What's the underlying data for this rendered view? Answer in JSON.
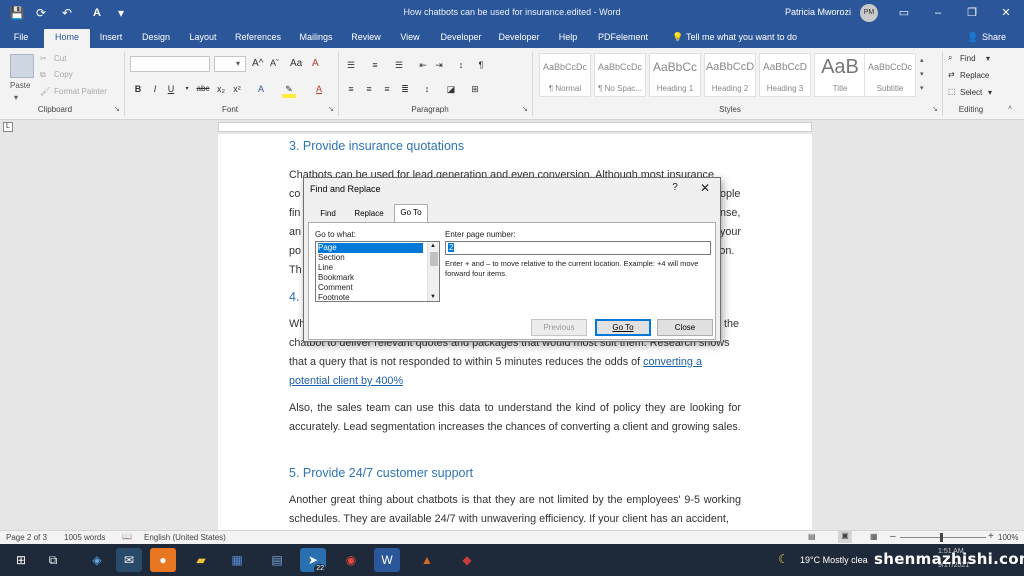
{
  "window": {
    "title": "How chatbots can be used for insurance.edited  -  Word",
    "user_name": "Patricia Mworozi",
    "user_initials": "PM",
    "autosave_icon": "save-icon",
    "minimize": "–",
    "restore": "❐",
    "close": "✕",
    "ribbon_display": "▭"
  },
  "tabs": [
    "File",
    "Home",
    "Insert",
    "Design",
    "Layout",
    "References",
    "Mailings",
    "Review",
    "View",
    "Developer",
    "Developer",
    "Help",
    "PDFelement"
  ],
  "active_tab": "Home",
  "tell_me": "Tell me what you want to do",
  "share": "Share",
  "clipboard": {
    "paste": "Paste",
    "cut": "Cut",
    "copy": "Copy",
    "format_painter": "Format Painter",
    "label": "Clipboard"
  },
  "font": {
    "label": "Font",
    "bold": "B",
    "italic": "I",
    "underline": "U",
    "strike": "abc",
    "sub": "x₂",
    "sup": "x²"
  },
  "paragraph": {
    "label": "Paragraph"
  },
  "styles": {
    "label": "Styles",
    "items": [
      {
        "preview": "AaBbCcDc",
        "name": "¶ Normal"
      },
      {
        "preview": "AaBbCcDc",
        "name": "¶ No Spac..."
      },
      {
        "preview": "AaBbCc",
        "name": "Heading 1"
      },
      {
        "preview": "AaBbCcD",
        "name": "Heading 2"
      },
      {
        "preview": "AaBbCcD",
        "name": "Heading 3"
      },
      {
        "preview": "AaB",
        "name": "Title"
      },
      {
        "preview": "AaBbCcDc",
        "name": "Subtitle"
      }
    ]
  },
  "editing": {
    "label": "Editing",
    "find": "Find",
    "replace": "Replace",
    "select": "Select"
  },
  "document": {
    "h3": "3.  Provide insurance quotations",
    "p3_lines": [
      "Chatbots can be used for lead generation and even conversion. Although most insurance",
      "co",
      "fin",
      "an",
      "po",
      "Th"
    ],
    "p3_right": [
      "ople",
      "nse,",
      "your",
      "tion."
    ],
    "h4": "4.",
    "p4_line1_left": "Wh",
    "p4_line1_right": "the",
    "p4_line2": "chatbot to deliver relevant quotes and packages that would most suit them. Research shows",
    "p4_line3": "that a query that is not responded to within 5 minutes reduces the odds of ",
    "p4_link1": "converting a",
    "p4_link2": "potential client by 400%",
    "p5": "Also, the sales team can use this data to understand the kind of policy they are looking for accurately. Lead segmentation increases the chances of converting a client and growing sales.",
    "h5": "5.  Provide 24/7 customer support",
    "p6": "Another great thing about chatbots is that they are not limited by the employees' 9-5 working schedules. They are available 24/7 with unwavering efficiency. If your client has an accident,"
  },
  "dialog": {
    "title": "Find and Replace",
    "help": "?",
    "close": "✕",
    "tabs": [
      "Find",
      "Replace",
      "Go To"
    ],
    "active_tab": "Go To",
    "goto_what_label": "Go to what:",
    "goto_items": [
      "Page",
      "Section",
      "Line",
      "Bookmark",
      "Comment",
      "Footnote"
    ],
    "selected_item": "Page",
    "page_number_label": "Enter page number:",
    "page_number_value": "2",
    "hint": "Enter + and – to move relative to the current location. Example: +4 will move forward four items.",
    "previous": "Previous",
    "goto_button": "Go To",
    "close_button": "Close"
  },
  "status": {
    "page": "Page 2 of 3",
    "words": "1005 words",
    "language": "English (United States)",
    "zoom": "100%",
    "zoom_minus": "–",
    "zoom_plus": "+"
  },
  "taskbar": {
    "weather": "19°C  Mostly clea",
    "time": "1:51 AM",
    "date": "9/17/2021",
    "badge": "22"
  },
  "watermark": "shenmazhishi.com"
}
